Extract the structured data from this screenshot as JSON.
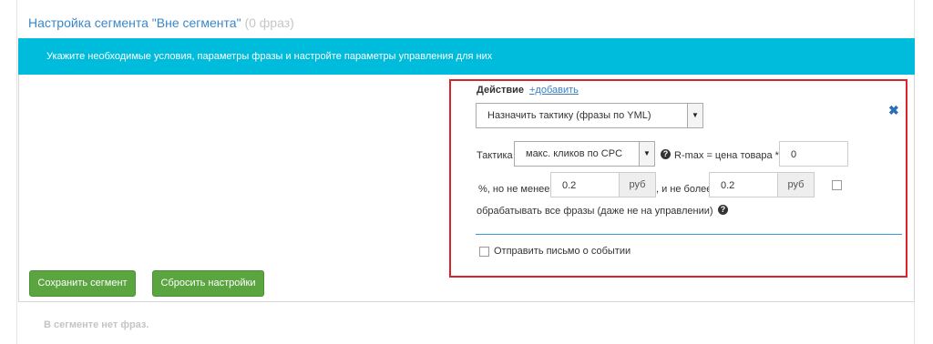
{
  "panel": {
    "title": "Настройка сегмента \"Вне сегмента\"",
    "count": "(0 фраз)"
  },
  "banner": {
    "text": "Укажите необходимые условия, параметры фразы и настройте параметры управления для них"
  },
  "action": {
    "title": "Действие",
    "add_link": "+добавить",
    "close_icon": "close-x",
    "selected": "Назначить тактику (фразы по YML)"
  },
  "tactic": {
    "label": "Тактика",
    "selected": "макс. кликов по CPC",
    "rmax_label": "R-max = цена товара *",
    "rmax_value": "0",
    "percent_min_label": "%, но не менее",
    "min_value": "0.2",
    "min_unit": "руб",
    "max_label": ", и не более",
    "max_value": "0.2",
    "max_unit": "руб",
    "all_phrases_label": "обрабатывать все фразы (даже не на управлении)"
  },
  "notify": {
    "label": "Отправить письмо о событии"
  },
  "buttons": {
    "save": "Сохранить сегмент",
    "reset": "Сбросить настройки"
  },
  "empty_note": "В сегменте нет фраз.",
  "colors": {
    "accent_blue": "#00bcdc",
    "title_blue": "#3a87c8",
    "highlight_red": "#d9232d",
    "button_green": "#5ba540"
  }
}
